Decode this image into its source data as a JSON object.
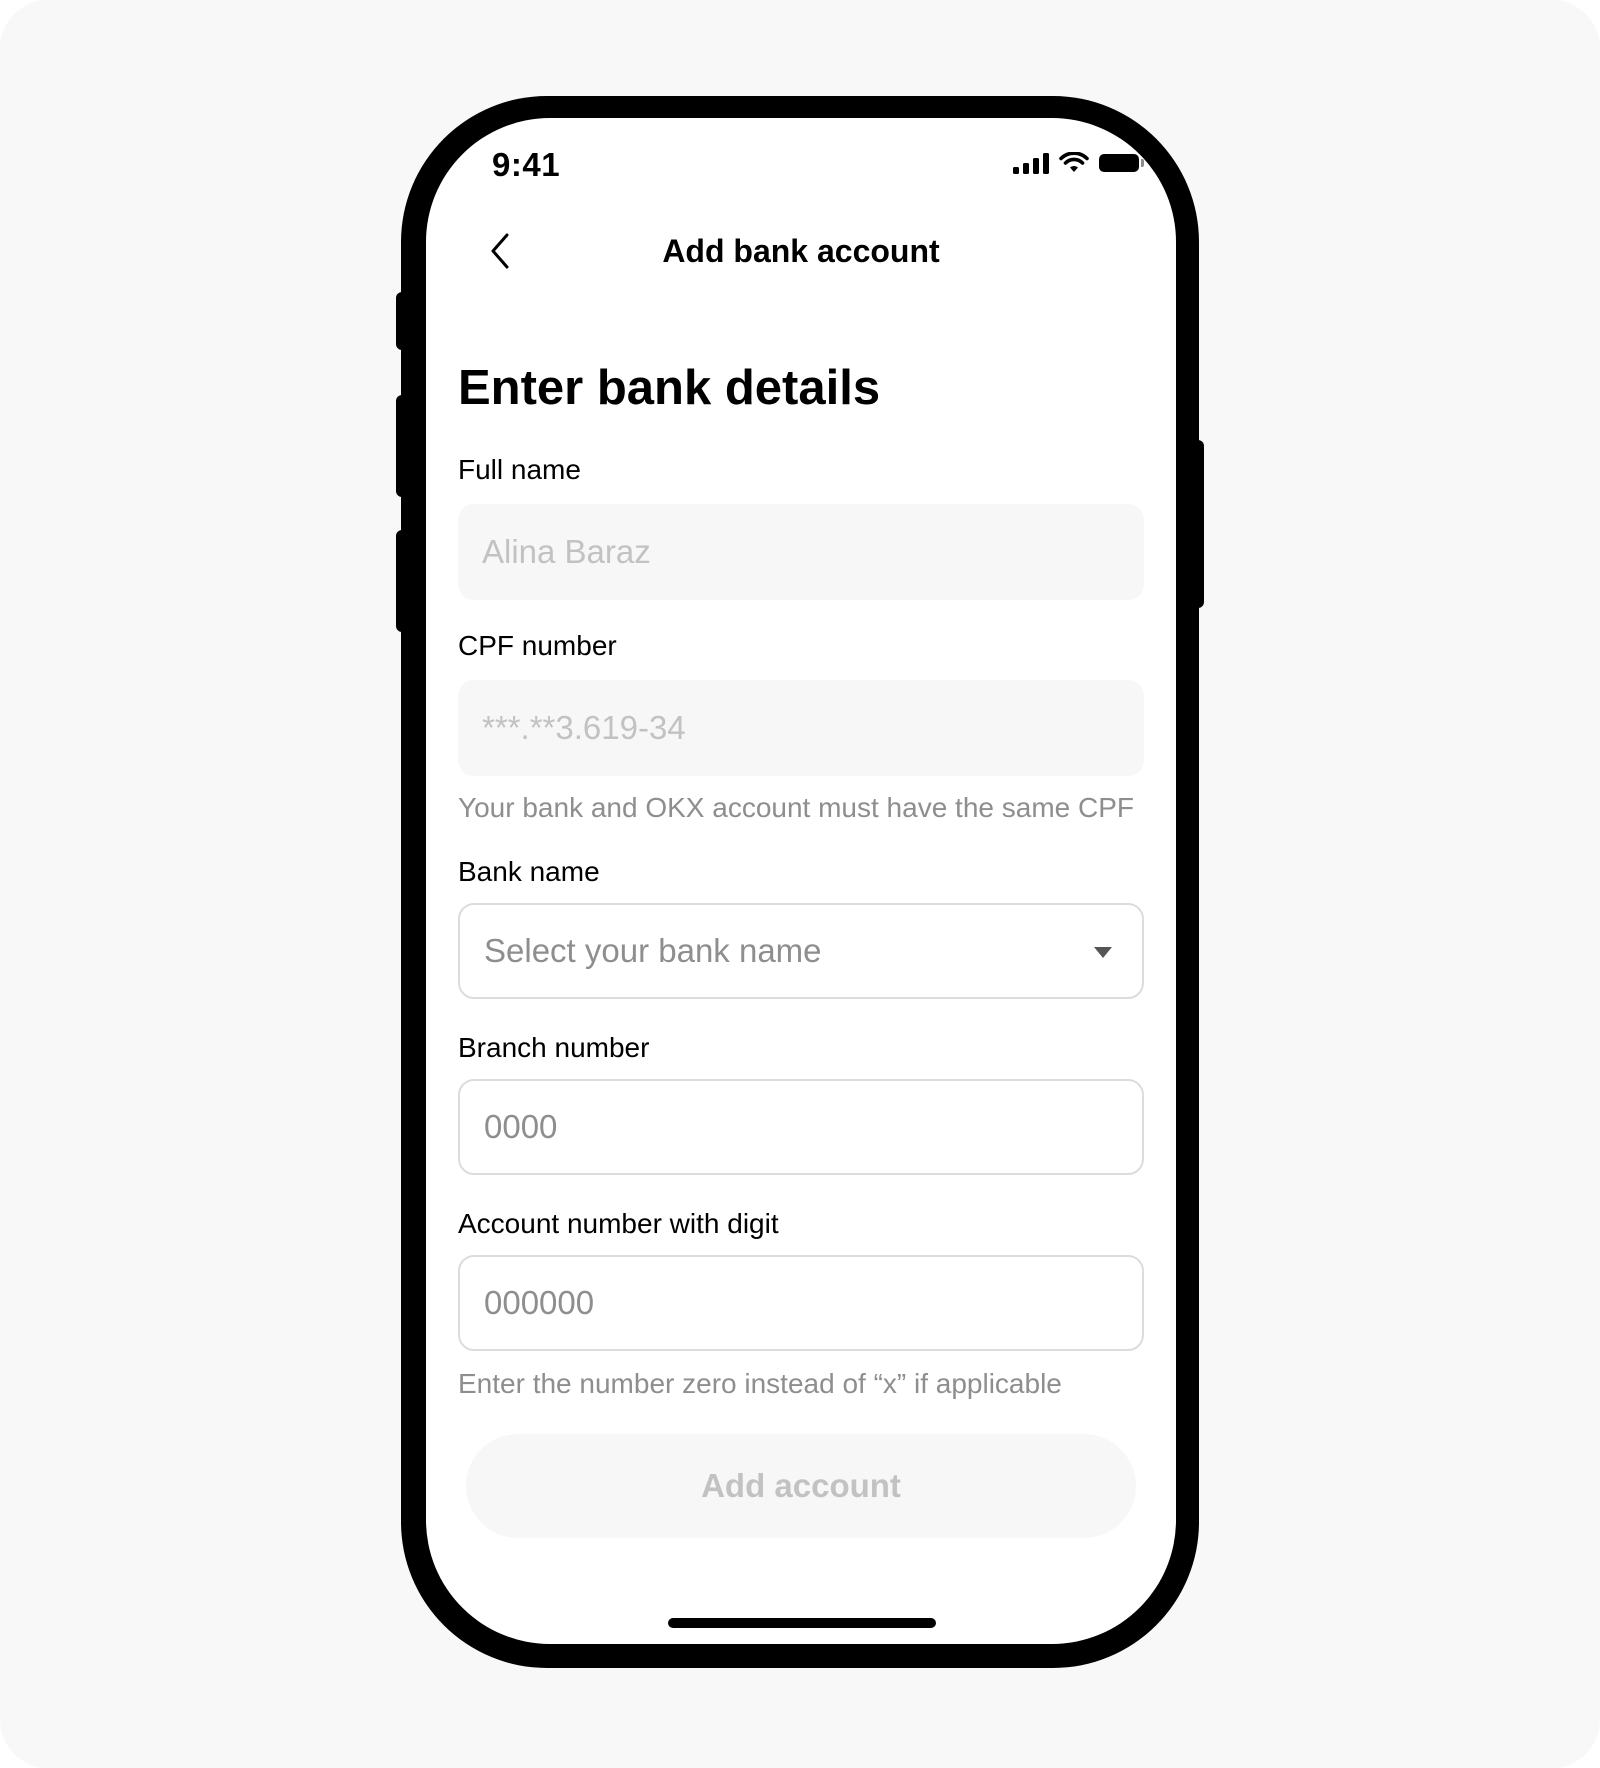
{
  "status_bar": {
    "time": "9:41",
    "icons": [
      "signal-icon",
      "wifi-icon",
      "battery-icon"
    ]
  },
  "header": {
    "back_icon": "chevron-left-icon",
    "title": "Add bank account"
  },
  "page": {
    "heading": "Enter bank details"
  },
  "form": {
    "full_name": {
      "label": "Full name",
      "value": "Alina Baraz"
    },
    "cpf": {
      "label": "CPF number",
      "value": "***.**3.619-34",
      "helper": "Your bank and OKX account must have the same CPF"
    },
    "bank_name": {
      "label": "Bank name",
      "placeholder": "Select your bank name",
      "icon": "caret-down-icon"
    },
    "branch": {
      "label": "Branch number",
      "placeholder": "0000"
    },
    "account": {
      "label": "Account number with digit",
      "placeholder": "000000",
      "helper": "Enter the number zero instead of “x” if applicable"
    }
  },
  "actions": {
    "submit_label": "Add account"
  },
  "colors": {
    "background": "#f8f8f8",
    "frame": "#000000",
    "text_primary": "#000000",
    "text_secondary": "#8e8e8e",
    "disabled_text": "#c2c2c2",
    "disabled_fill": "#f7f7f7",
    "border": "#dcdcdc"
  }
}
